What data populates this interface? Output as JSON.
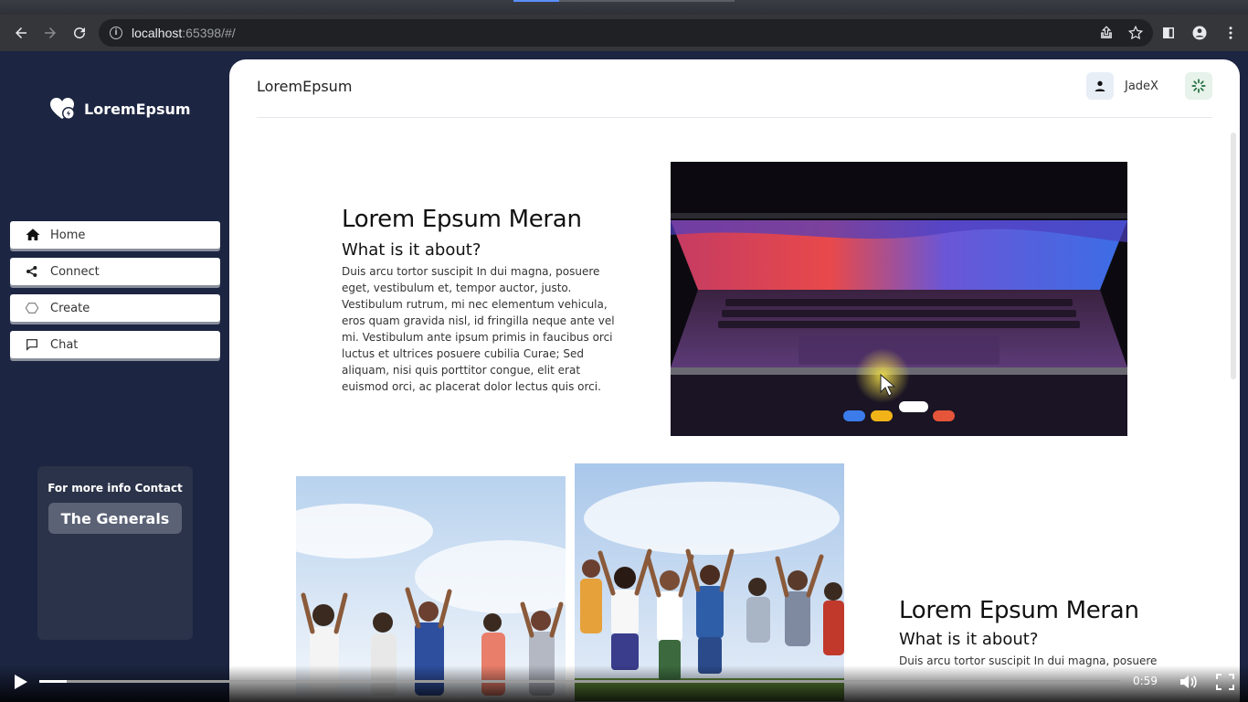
{
  "browser": {
    "url_host": "localhost",
    "url_rest": ":65398/#/"
  },
  "sidebar": {
    "logo_text": "LoremEpsum",
    "items": [
      {
        "label": "Home",
        "icon": "home-icon"
      },
      {
        "label": "Connect",
        "icon": "share-icon"
      },
      {
        "label": "Create",
        "icon": "hexagon-icon"
      },
      {
        "label": "Chat",
        "icon": "chat-icon"
      }
    ],
    "contact": {
      "title": "For more info Contact",
      "button": "The Generals"
    }
  },
  "header": {
    "title": "LoremEpsum",
    "user_name": "JadeX"
  },
  "hero": {
    "heading": "Lorem Epsum Meran",
    "subheading": "What is it about?",
    "body": "Duis arcu tortor suscipit In dui magna, posuere eget, vestibulum et, tempor auctor, justo. Vestibulum rutrum, mi nec elementum vehicula, eros quam gravida nisl, id fringilla neque ante vel mi. Vestibulum ante ipsum primis in faucibus orci luctus et ultrices posuere cubilia Curae; Sed aliquam, nisi quis porttitor congue, elit erat euismod orci, ac placerat dolor lectus quis orci."
  },
  "second": {
    "heading": "Lorem Epsum Meran",
    "subheading": "What is it about?",
    "body": "Duis arcu tortor suscipit In dui magna, posuere"
  },
  "video": {
    "time": "0:59",
    "progress_fraction": 0.025
  },
  "colors": {
    "sidebar_bg": "#1c2541",
    "content_bg": "#ffffff",
    "card_bg": "#2a3349"
  }
}
